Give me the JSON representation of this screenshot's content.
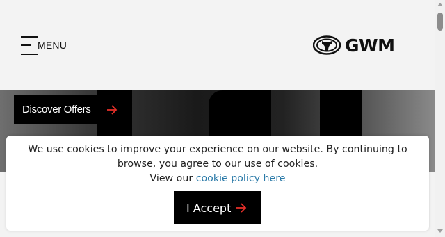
{
  "header": {
    "menu_label": "MENU",
    "logo_text": "GWM"
  },
  "hero": {
    "offers_label": "Discover Offers"
  },
  "cookie_banner": {
    "message": "We use cookies to improve your experience on our website. By continuing to browse, you agree to our use of cookies.",
    "view_prefix": "View our",
    "policy_link": "cookie policy here",
    "accept_label": "I Accept"
  },
  "colors": {
    "accent": "#e8302a",
    "link": "#2b7aa8",
    "dark": "#000000"
  }
}
